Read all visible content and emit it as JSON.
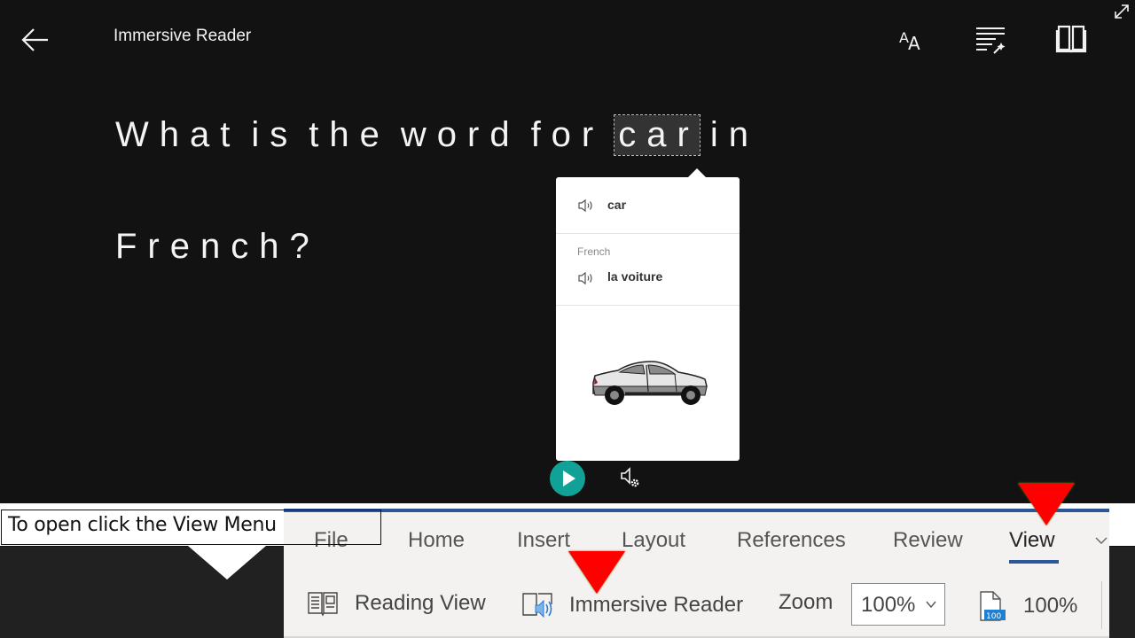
{
  "header": {
    "title": "Immersive Reader",
    "icons": [
      "back-arrow-icon",
      "text-preferences-icon",
      "grammar-options-icon",
      "reading-preferences-icon",
      "expand-icon"
    ]
  },
  "reading": {
    "line1": [
      "What",
      "is",
      "the",
      "word",
      "for",
      "car",
      "in"
    ],
    "line2": [
      "French?"
    ],
    "selected_word": "car"
  },
  "picture_dictionary": {
    "word": "car",
    "language_label": "French",
    "translation": "la voiture",
    "image": "car-illustration"
  },
  "playback": {
    "play_icon": "play-icon",
    "voice_settings_icon": "voice-settings-icon",
    "accent": "#12a196"
  },
  "callout": {
    "text": "To open click the View Menu"
  },
  "ribbon": {
    "accent": "#2b579a",
    "tabs": [
      {
        "label": "File",
        "active": false
      },
      {
        "label": "Home",
        "active": false
      },
      {
        "label": "Insert",
        "active": false
      },
      {
        "label": "Layout",
        "active": false
      },
      {
        "label": "References",
        "active": false
      },
      {
        "label": "Review",
        "active": false
      },
      {
        "label": "View",
        "active": true
      }
    ],
    "commands": {
      "reading_view": "Reading View",
      "immersive_reader": "Immersive Reader",
      "zoom_label": "Zoom",
      "zoom_value": "100%",
      "zoom_100_label": "100%"
    }
  },
  "markers": {
    "color": "#ff0000"
  }
}
